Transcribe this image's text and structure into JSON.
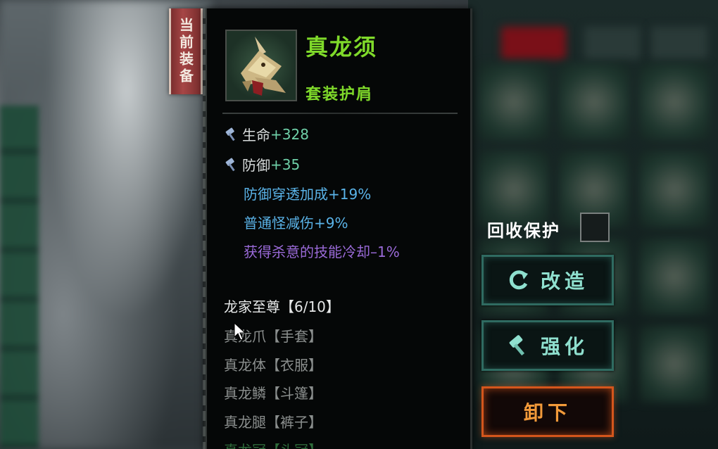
{
  "tag": {
    "label": "当前装备"
  },
  "item": {
    "name": "真龙须",
    "type": "套装护肩",
    "icon": "dragon-whisker-shoulder-icon",
    "name_color": "#7fd92a"
  },
  "stats": {
    "base": [
      {
        "name": "生命",
        "value": "+328"
      },
      {
        "name": "防御",
        "value": "+35"
      }
    ],
    "extra": [
      {
        "text": "防御穿透加成+19%",
        "color": "#5ab3e8"
      },
      {
        "text": "普通怪减伤+9%",
        "color": "#5ab3e8"
      },
      {
        "text": "获得杀意的技能冷却–1%",
        "color": "#9a6ad8"
      }
    ]
  },
  "set": {
    "title": "龙家至尊【6/10】",
    "items": [
      "真龙爪【手套】",
      "真龙体【衣服】",
      "真龙鳞【斗篷】",
      "真龙腿【裤子】"
    ],
    "partial_item": "真龙冠【头冠】"
  },
  "actions": {
    "protect_label": "回收保护",
    "protect_checked": false,
    "reforge_label": "改造",
    "enhance_label": "强化",
    "unequip_label": "卸下"
  }
}
